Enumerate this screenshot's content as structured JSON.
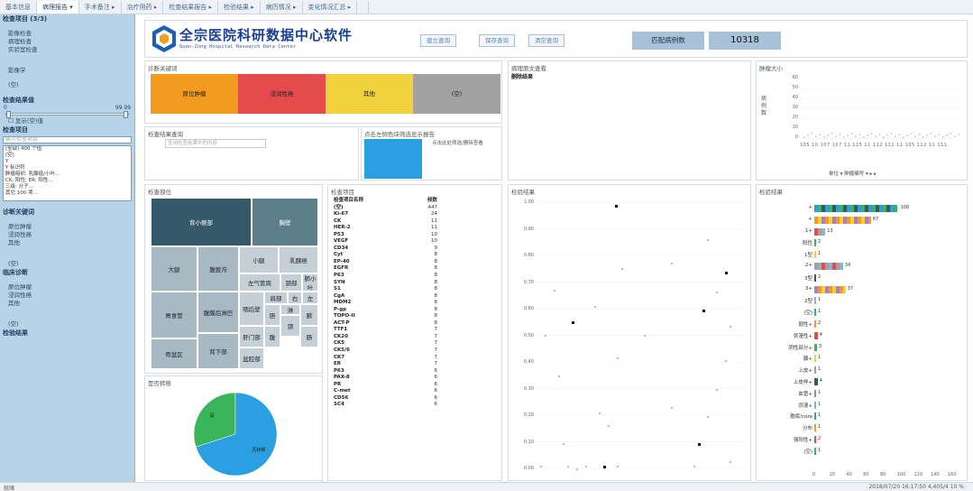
{
  "tabs": [
    "基本信息",
    "病理报告 ▾",
    "手术备注 ▸",
    "治疗用药 ▸",
    "检查结果报告 ▸",
    "检验结果 ▸",
    "病历情况 ▸",
    "变化情况汇总 ▸",
    ""
  ],
  "sidebar": {
    "search_placeholder": "输入检查项目",
    "section1": {
      "title": "检查项目 (3/3)",
      "items": [
        "影像检查",
        "病理检查",
        "实验室检查"
      ]
    },
    "sortlist": [
      "影像学"
    ],
    "null1": "(空)",
    "section2": {
      "title": "检查结果值",
      "from": "0",
      "to": "99.99"
    },
    "checkbox": "显示(空)值",
    "section3": {
      "title": "检查项目"
    },
    "list": [
      "(全部) 400 个值",
      "(空)",
      "Y",
      "Y 标识符",
      "肿瘤组织: 乳腺癌/小叶…",
      "CK: 阳性; ER: 阳性…",
      "三级: 分子…",
      "其它 100 项…"
    ],
    "section4": {
      "title": "诊断关键词",
      "items": [
        "原位肿瘤",
        "浸润性癌",
        "其他"
      ]
    },
    "null2": "(空)",
    "section5": {
      "title": "临床诊断",
      "items": [
        "原位肿瘤",
        "浸润性癌",
        "其他"
      ]
    },
    "null3": "(空)",
    "section6": {
      "title": "检验结果"
    }
  },
  "header": {
    "brand": "全宗医院科研数据中心软件",
    "brand_sub": "Quan-Zong Hospital Research Data Center",
    "buttons": [
      "建立查询",
      "保存查询",
      "清空查询"
    ],
    "match_label": "匹配病例数",
    "match_value": "10318"
  },
  "keywords": {
    "title": "诊断关键词",
    "blocks": [
      {
        "label": "原位肿瘤",
        "color": "#f39b1e"
      },
      {
        "label": "浸润性癌",
        "color": "#e64b4b"
      },
      {
        "label": "其他",
        "color": "#f2d23c"
      },
      {
        "label": "(空)",
        "color": "#a1a1a1"
      }
    ]
  },
  "search": {
    "title": "检查结果查询",
    "placeholder": "查询检查结果中的内容"
  },
  "bluepanel": {
    "title": "点击左侧色块筛选显示报告",
    "hint": "点击此处筛选/删除查看"
  },
  "textpanel": {
    "title": "病理原文查看",
    "subtitle": "删除结果"
  },
  "sizepanel": {
    "title": "肿瘤大小",
    "axis_label": "病例数",
    "yticks": [
      "60",
      "50",
      "40",
      "30",
      "20",
      "10",
      "0"
    ],
    "legend": "单位 ▾  肿瘤编号 ▾ ▸ ▸"
  },
  "bodysite": {
    "title": "检查部位",
    "cells": [
      {
        "label": "背小侧部",
        "color": "#355969"
      },
      {
        "label": "胸壁",
        "color": "#5d7e8b"
      },
      {
        "label": "大腿",
        "color": "#a7bac3"
      },
      {
        "label": "腹股沟",
        "color": "#a7bac3"
      },
      {
        "label": "小腿",
        "color": "#c4d0d6"
      },
      {
        "label": "乳腺癌",
        "color": "#c4d0d6"
      },
      {
        "label": "左气管周",
        "color": "#c4d0d6"
      },
      {
        "label": "颈部",
        "color": "#c4d0d6"
      },
      {
        "label": "肺小叶",
        "color": "#c4d0d6"
      },
      {
        "label": "胃食管",
        "color": "#a7bac3"
      },
      {
        "label": "腹膜后淋巴",
        "color": "#a7bac3"
      },
      {
        "label": "咽后壁",
        "color": "#c4d0d6"
      },
      {
        "label": "肩部",
        "color": "#c4d0d6"
      },
      {
        "label": "右",
        "color": "#c4d0d6"
      },
      {
        "label": "左",
        "color": "#c4d0d6"
      },
      {
        "label": "骨盆区",
        "color": "#a7bac3"
      },
      {
        "label": "背下部",
        "color": "#a7bac3"
      },
      {
        "label": "肝门部",
        "color": "#c4d0d6"
      },
      {
        "label": "胆",
        "color": "#c4d0d6"
      },
      {
        "label": "淋",
        "color": "#c4d0d6"
      },
      {
        "label": "腋",
        "color": "#c4d0d6"
      },
      {
        "label": "盆腔部",
        "color": "#c4d0d6"
      },
      {
        "label": "腹",
        "color": "#c4d0d6"
      },
      {
        "label": "颈",
        "color": "#c4d0d6"
      },
      {
        "label": "肠",
        "color": "#c4d0d6"
      }
    ]
  },
  "pie": {
    "title": "是否转移",
    "slices": [
      {
        "label": "是",
        "value": 30,
        "color": "#3cb55a"
      },
      {
        "label": "否转移",
        "value": 70,
        "color": "#2a9fe2"
      }
    ]
  },
  "items_table": {
    "title": "检查项目",
    "header": [
      "检查项目名称",
      "频数"
    ],
    "rows": [
      [
        "(空)",
        "447"
      ],
      [
        "Ki-67",
        "24"
      ],
      [
        "CK",
        "11"
      ],
      [
        "HER-2",
        "11"
      ],
      [
        "P53",
        "10"
      ],
      [
        "VEGF",
        "10"
      ],
      [
        "CD34",
        "9"
      ],
      [
        "Cyt",
        "8"
      ],
      [
        "EP-40",
        "8"
      ],
      [
        "EGFR",
        "8"
      ],
      [
        "P63",
        "8"
      ],
      [
        "SYN",
        "8"
      ],
      [
        "S1",
        "8"
      ],
      [
        "CgA",
        "8"
      ],
      [
        "MDM2",
        "8"
      ],
      [
        "P-gp",
        "8"
      ],
      [
        "TOPO-II",
        "8"
      ],
      [
        "ACT-P",
        "8"
      ],
      [
        "TTF1",
        "7"
      ],
      [
        "CK20",
        "7"
      ],
      [
        "CK5",
        "7"
      ],
      [
        "CK5/6",
        "7"
      ],
      [
        "CK7",
        "7"
      ],
      [
        "ER",
        "7"
      ],
      [
        "P63",
        "6"
      ],
      [
        "PAX-8",
        "6"
      ],
      [
        "PR",
        "6"
      ],
      [
        "C-met",
        "6"
      ],
      [
        "CD56",
        "6"
      ],
      [
        "SC4",
        "6"
      ]
    ]
  },
  "scatter": {
    "title": "检验结果",
    "yticks": [
      "1.00",
      "0.90",
      "0.80",
      "0.70",
      "0.60",
      "0.50",
      "0.40",
      "0.30",
      "0.20",
      "0.10",
      "0.00"
    ]
  },
  "hbar": {
    "title": "检验结果",
    "rows": [
      {
        "label": "+",
        "value": 100
      },
      {
        "label": "+",
        "value": 67
      },
      {
        "label": "1+",
        "value": 13
      },
      {
        "label": "阳性",
        "value": 2
      },
      {
        "label": "1型",
        "value": 1
      },
      {
        "label": "2+",
        "value": 34
      },
      {
        "label": "3型",
        "value": 2
      },
      {
        "label": "3+",
        "value": 37
      },
      {
        "label": "2型",
        "value": 1
      },
      {
        "label": "(空)",
        "value": 1
      },
      {
        "label": "弱性+",
        "value": 2
      },
      {
        "label": "弥漫性+",
        "value": 4
      },
      {
        "label": "阴性部分+",
        "value": 3
      },
      {
        "label": "腺+",
        "value": 1
      },
      {
        "label": "上皮+",
        "value": 1
      },
      {
        "label": "上皮样+",
        "value": 4
      },
      {
        "label": "血管+",
        "value": 1
      },
      {
        "label": "弥漫+",
        "value": 1
      },
      {
        "label": "胞浆/core",
        "value": 1
      },
      {
        "label": "分布",
        "value": 1
      },
      {
        "label": "强阳性+",
        "value": 2
      },
      {
        "label": "(空)",
        "value": 1
      }
    ],
    "xticks": [
      "0",
      "20",
      "40",
      "60",
      "80",
      "100",
      "120",
      "140",
      "160"
    ]
  },
  "status": {
    "left": "就绪",
    "right": "2018/07/20 16:17:50   4,405/4   10 %"
  }
}
